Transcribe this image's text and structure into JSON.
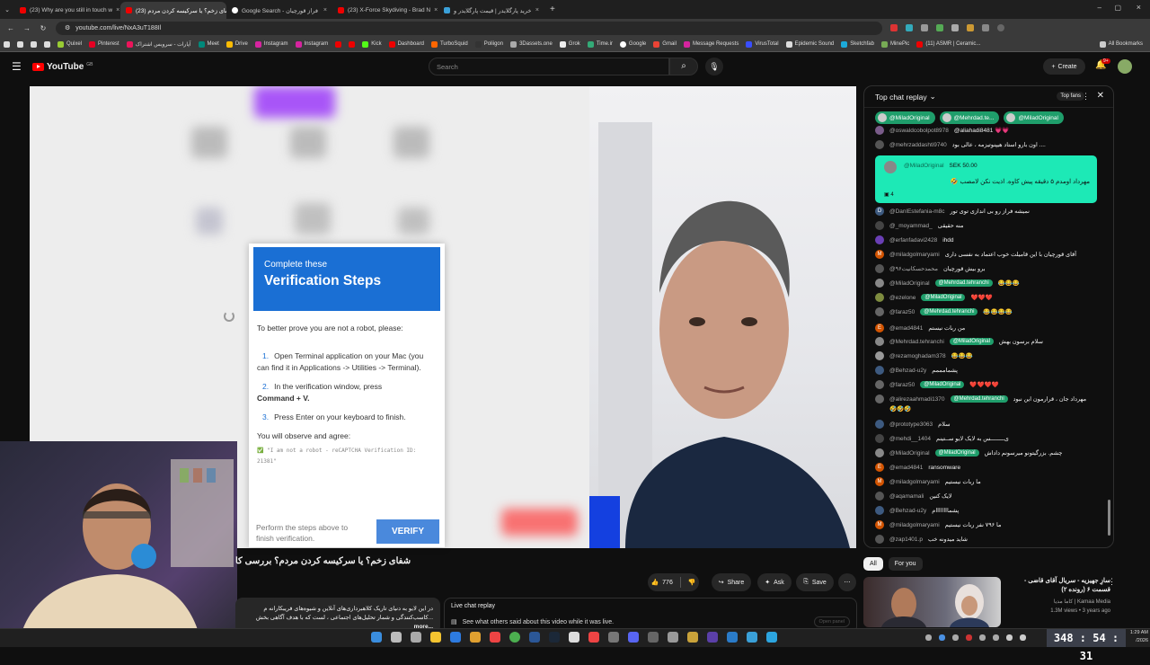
{
  "browser": {
    "tabs": [
      {
        "label": "(23) Why are you still in touch w"
      },
      {
        "label": "(23) شفای زخم؟ یا سرکیسه کردن مردم",
        "active": true
      },
      {
        "label": "Google Search - فراز قورچیان"
      },
      {
        "label": "(23) X-Force Skydiving - Brad N"
      },
      {
        "label": "خرید پارگلایدر | قیمت پارگلایدر و"
      }
    ],
    "url": "youtube.com/live/NxA3uT188Il",
    "bookmarks": [
      "Quixel",
      "Pinterest",
      "آپارات - سرویس اشتراک",
      "Meet",
      "Drive",
      "Instagram",
      "Instagram",
      "Kick",
      "Dashboard",
      "TurboSquid",
      "Poliigon",
      "3Dassets.one",
      "Grok",
      "Time.ir",
      "Google",
      "Gmail",
      "Message Requests",
      "VirusTotal",
      "Epidemic Sound",
      "Sketchfab",
      "MinePic",
      "(11) ASMR | Ceramic...",
      "All Bookmarks"
    ]
  },
  "masthead": {
    "logo": "YouTube",
    "country": "GB",
    "search_placeholder": "Search",
    "create_label": "Create",
    "notif_count": "9+"
  },
  "modal": {
    "head_small": "Complete these",
    "head_large": "Verification Steps",
    "intro": "To better prove you are not a robot, please:",
    "step1_num": "1.",
    "step1": "Open Terminal application on your Mac (you can find it in Applications -> Utilities -> Terminal).",
    "step2_num": "2.",
    "step2_a": "In the verification window, press",
    "step2_b": "Command + V.",
    "step3_num": "3.",
    "step3": "Press Enter on your keyboard to finish.",
    "observe": "You will observe and agree:",
    "code": "✅ \"I am not a robot - reCAPTCHA Verification ID: 21381\"",
    "footer": "Perform the steps above to finish verification.",
    "verify_label": "VERIFY"
  },
  "video": {
    "title": "شفای زخم؟ یا سرکیسه کردن مردم؟ بررسی کا",
    "like_count": "776",
    "share_label": "Share",
    "ask_label": "Ask",
    "save_label": "Save",
    "description": "در این لایو به دنیای تاریک کلاهبرداری‌های آنلاین و شیوه‌های فریبکارانه م ...کاسب‌کنندگی و شمار تحلیل‌های اجتماعی ، لست که با هدف آگاهی بخش",
    "more_label": "...more",
    "replay_title": "Live chat replay",
    "replay_desc": "See what others said about this video while it was live.",
    "open_panel": "Open panel"
  },
  "chat": {
    "header": "Top chat replay",
    "top_fans": "Top fans",
    "chips": [
      "@MiladOriginal",
      "@Mehrdad.te...",
      "@MiladOriginal"
    ],
    "superchat": {
      "author": "@MiladOriginal",
      "amount": "SEK 50.00",
      "text": "مهرداد اومدم ۵ دقیقه پیش کاوه. اذیت نکن لامصب 🤣",
      "count": "4"
    },
    "messages": [
      {
        "author": "@oswaldcobolpot8978",
        "text": "@aliahadi8481 💗💗",
        "color": "#7a5c8a"
      },
      {
        "author": "@mehrzaddashti9740",
        "text": "اون بارو استاد هیپنوتیزمه ، عالی بود ....",
        "color": "#555"
      },
      {
        "author": "@DanlEstefania-m8c",
        "text": "نمیشه فراز رو بی اندازی توی تور",
        "color": "#3d5a80",
        "letter": "D"
      },
      {
        "author": "@_moyammad_",
        "text": "منه حقیقی",
        "color": "#444"
      },
      {
        "author": "@erfanfadavi2428",
        "text": "ihdd",
        "color": "#6a3fb5"
      },
      {
        "author": "@miladgolmaryami",
        "text": "آقای قورچیان با این قامیلت خوب اعتماد به نفسی داری",
        "color": "#d35400",
        "letter": "M"
      },
      {
        "author": "@محمدحسکانیت۹۶",
        "text": "برو بیش قورچیان",
        "color": "#555"
      },
      {
        "author": "@MiladOriginal",
        "badge": "@Mehrdad.tehranchi",
        "text": "😂😂😂",
        "color": "#888"
      },
      {
        "author": "@ezelone",
        "badge": "@MiladOriginal",
        "text": "❤️❤️❤️",
        "color": "#7e8c3f"
      },
      {
        "author": "@faraz50",
        "badge": "@Mehrdad.tehranchi",
        "text": "😂😂😂😂",
        "color": "#666"
      },
      {
        "author": "@emad4841",
        "text": "من ربات نیستم",
        "color": "#d35400",
        "letter": "E"
      },
      {
        "author": "@Mehrdad.tehranchi",
        "badge": "@MiladOriginal",
        "text": "سلام برسون بهش",
        "color": "#888"
      },
      {
        "author": "@rezamoghadam378",
        "text": "😂😂😂",
        "color": "#999"
      },
      {
        "author": "@Behzad-u2y",
        "text": "پشمامممم",
        "color": "#3d5a80"
      },
      {
        "author": "@faraz50",
        "badge": "@MiladOriginal",
        "text": "❤️❤️❤️❤️",
        "color": "#666"
      },
      {
        "author": "@alirezaahmadi1370",
        "badge": "@Mehrdad.tehranchi",
        "text": "مهرداد جان ، قرارمون این نبود",
        "text2": "🤣🤣🤣",
        "color": "#666"
      },
      {
        "author": "@prototype3063",
        "text": "سلام",
        "color": "#3d5a80"
      },
      {
        "author": "@mehdi__1404",
        "text": "ی‌ــــــــس به لایک لایو ســتینم",
        "color": "#444"
      },
      {
        "author": "@MiladOriginal",
        "badge": "@MiladOriginal",
        "text": "چشم. بزرگیتونو میرسونم داداش",
        "color": "#888"
      },
      {
        "author": "@emad4841",
        "text": "ransomware",
        "color": "#d35400",
        "letter": "E"
      },
      {
        "author": "@miladgolmaryami",
        "text": "ما ربات نیستیم",
        "color": "#d35400",
        "letter": "M"
      },
      {
        "author": "@aqamamali",
        "text": "لایک کنین",
        "color": "#555"
      },
      {
        "author": "@Behzad-u2y",
        "text": "پشماااااااام",
        "color": "#3d5a80"
      },
      {
        "author": "@miladgolmaryami",
        "text": "ما ۷۹۶ نفر ربات نیستیم",
        "color": "#d35400",
        "letter": "M"
      },
      {
        "author": "@zap1401.p",
        "text": "شاید میدونه خب",
        "color": "#555"
      }
    ]
  },
  "related": {
    "chips": [
      "All",
      "For you"
    ],
    "title": "سازِ جهیزیه - سریال آقای قاضی - قسمت ۶ (رونده ۲)",
    "channel": "Kamaa Media | کاما مدیا",
    "meta": "1.3M views • 3 years ago"
  },
  "taskbar": {
    "timer": "348 : 54 : 31",
    "time": "1:29 AM",
    "date": "/2026"
  }
}
